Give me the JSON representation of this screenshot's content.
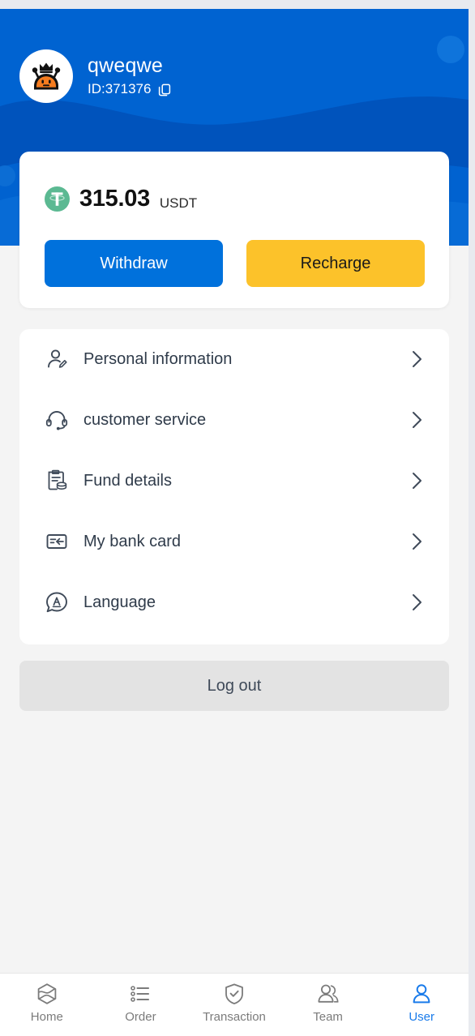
{
  "theme": {
    "header_blue": "#0063d1",
    "header_wave_dark": "#0050b9",
    "accent_blue": "#0071dc",
    "accent_yellow": "#fcc22a",
    "usdt_green": "#5bb992",
    "page_bg": "#f4f4f4",
    "active_nav": "#1a7bea"
  },
  "profile": {
    "username": "qweqwe",
    "id_label": "ID:371376",
    "avatar_icon": "robot-crown-avatar-icon",
    "copy_icon": "copy-icon"
  },
  "balance": {
    "amount": "315.03",
    "currency": "USDT",
    "currency_icon": "tether-usdt-icon",
    "withdraw_label": "Withdraw",
    "recharge_label": "Recharge"
  },
  "menu": {
    "items": [
      {
        "label": "Personal information",
        "icon": "user-edit-icon"
      },
      {
        "label": "customer service",
        "icon": "headset-icon"
      },
      {
        "label": "Fund details",
        "icon": "fund-details-icon"
      },
      {
        "label": "My bank card",
        "icon": "bank-card-icon"
      },
      {
        "label": "Language",
        "icon": "language-icon"
      }
    ]
  },
  "logout": {
    "label": "Log out"
  },
  "bottom_nav": {
    "items": [
      {
        "label": "Home",
        "icon": "hexagon-home-icon",
        "active": false
      },
      {
        "label": "Order",
        "icon": "list-order-icon",
        "active": false
      },
      {
        "label": "Transaction",
        "icon": "shield-check-icon",
        "active": false
      },
      {
        "label": "Team",
        "icon": "people-team-icon",
        "active": false
      },
      {
        "label": "User",
        "icon": "user-person-icon",
        "active": true
      }
    ]
  }
}
